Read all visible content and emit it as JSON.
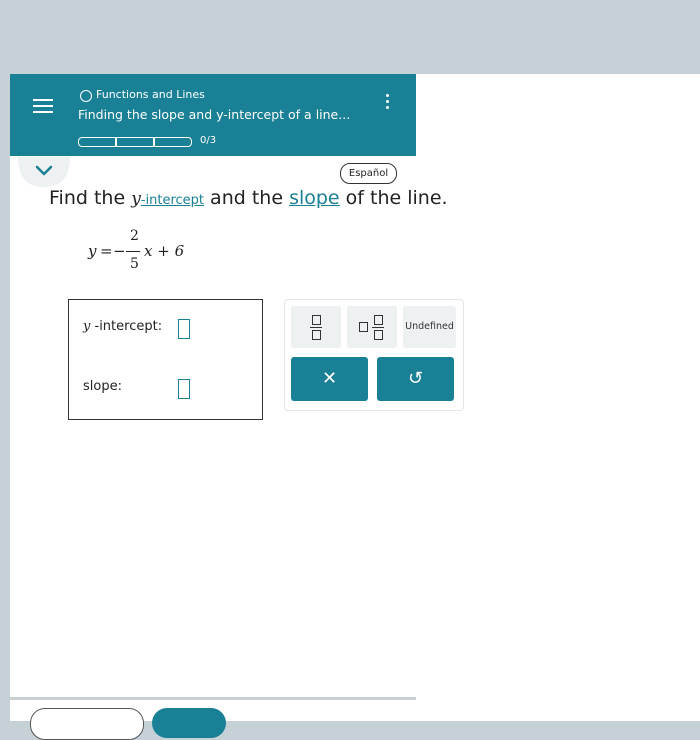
{
  "header": {
    "topic": "Functions and Lines",
    "lesson_title": "Finding the slope and y-intercept of a line...",
    "progress_text": "0/3",
    "progress_segments": 3,
    "progress_filled": 0
  },
  "language_button": "Español",
  "question": {
    "prefix": "Find the ",
    "y_var": "y",
    "dash": "-",
    "intercept_link": "intercept",
    "middle": " and the ",
    "slope_link": "slope",
    "suffix": " of the line."
  },
  "equation": {
    "lhs": "y",
    "equals": "=",
    "minus": "−",
    "numerator": "2",
    "denominator": "5",
    "rest": "x + 6"
  },
  "answers": {
    "y_var": "y",
    "y_intercept_label": "-intercept:",
    "y_intercept_value": "",
    "slope_label": "slope:",
    "slope_value": ""
  },
  "keypad": {
    "undefined_label": "Undefined",
    "clear_symbol": "✕",
    "undo_symbol": "↺"
  },
  "colors": {
    "accent": "#1a8096",
    "background_gray": "#c5d0d7"
  },
  "icons": [
    "menu-icon",
    "more-vertical-icon",
    "chevron-down-icon",
    "fraction-icon",
    "mixed-number-icon",
    "close-icon",
    "undo-icon"
  ]
}
